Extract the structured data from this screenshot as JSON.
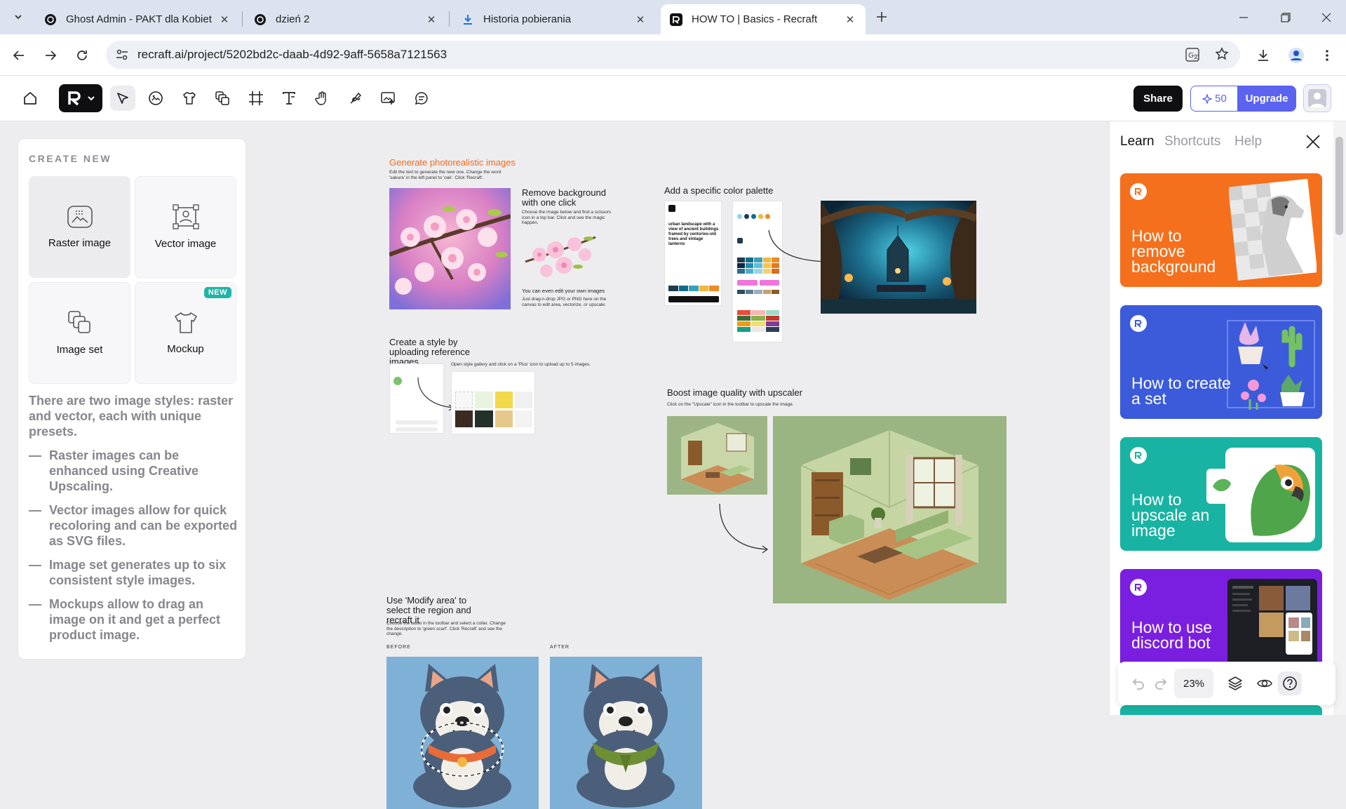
{
  "browser": {
    "tabs": [
      {
        "title": "Ghost Admin - PAKT dla Kobiet"
      },
      {
        "title": "dzień 2"
      },
      {
        "title": "Historia pobierania"
      },
      {
        "title": "HOW TO | Basics - Recraft"
      }
    ],
    "url": "recraft.ai/project/5202bd2c-daab-4d92-9aff-5658a7121563"
  },
  "toolbar": {
    "share_label": "Share",
    "credits": "50",
    "upgrade_label": "Upgrade"
  },
  "create_panel": {
    "header": "CREATE NEW",
    "cards": [
      {
        "label": "Raster image"
      },
      {
        "label": "Vector image"
      },
      {
        "label": "Image set"
      },
      {
        "label": "Mockup",
        "badge": "NEW"
      }
    ],
    "intro": "There are two image styles: raster and vector, each with unique presets.",
    "bullets": [
      "Raster images can be enhanced using Creative Upscaling.",
      "Vector images allow for quick recoloring and can be exported as SVG files.",
      "Image set generates up to six consistent style images.",
      "Mockups allow to drag an image on it and get a perfect product image."
    ]
  },
  "canvas": {
    "gen_title": "Generate photorealistic images",
    "gen_desc": "Edit the text to generate the new one. Change the word 'sakura' in the left panel to 'oak'. Click 'Recraft'.",
    "rb_title": "Remove background with one click",
    "rb_desc": "Choose the image below and find a scissors icon in a top bar. Click and see the magic happen.",
    "edit_title": "You can even edit your own images",
    "edit_desc": "Just drag-n-drop JPG or PNG here on the canvas to edit area, vectorize, or upscale.",
    "palette_title": "Add a specific color palette",
    "palette_prompt": "urban landscape with a view of ancient buildings framed by centuries-old trees and vintage lanterns",
    "style_title": "Create a style by uploading reference images",
    "style_desc": "Open style gallery and click on a 'Plus' icon to upload up to 5 images.",
    "upscale_title": "Boost image quality with upscaler",
    "upscale_desc": "Click on the \"Upscale\" icon in the toolbar to upscale the image.",
    "modify_title": "Use 'Modify area' to select the region  and recraft it",
    "modify_desc": "Choose the lasso in the toolbar and select a collar. Change the description to 'green scarf'. Click 'Recraft' and see the change.",
    "before_label": "BEFORE",
    "after_label": "AFTER"
  },
  "right_panel": {
    "tabs": [
      "Learn",
      "Shortcuts",
      "Help"
    ],
    "cards": [
      {
        "title": "How to remove background",
        "color": "#f5701d"
      },
      {
        "title": "How to create a set",
        "color": "#3b5bdb"
      },
      {
        "title": "How to upscale an image",
        "color": "#19b3a3"
      },
      {
        "title": "How to use discord bot",
        "color": "#7a1fe0"
      }
    ]
  },
  "bottom_bar": {
    "zoom": "23%"
  }
}
